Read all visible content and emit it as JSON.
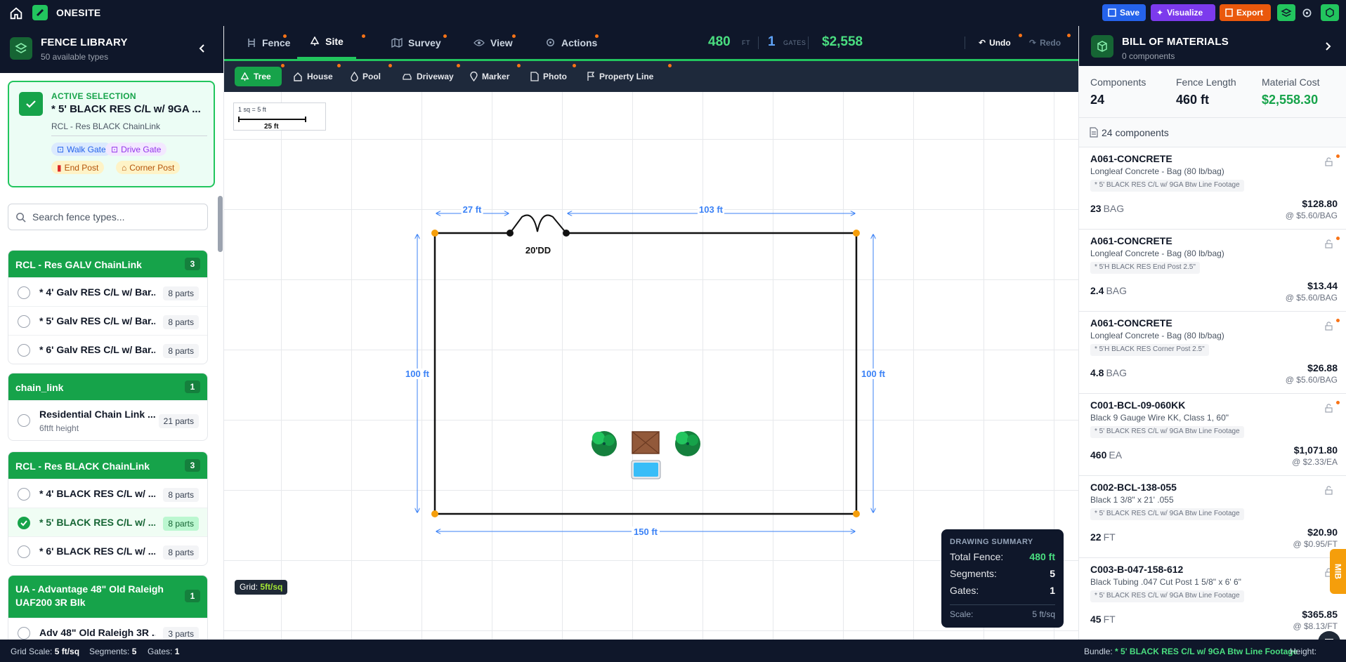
{
  "topbar": {
    "brand": "ONESITE",
    "save": "Save",
    "visualize": "Visualize",
    "export": "Export"
  },
  "library": {
    "title": "FENCE LIBRARY",
    "subtitle": "50 available types",
    "active": {
      "label": "ACTIVE SELECTION",
      "name": "* 5' BLACK RES C/L w/ 9GA ...",
      "sub": "RCL - Res BLACK ChainLink",
      "tags": [
        "Walk Gate",
        "Drive Gate",
        "End Post",
        "Corner Post"
      ]
    },
    "search_placeholder": "Search fence types...",
    "groups": [
      {
        "name": "RCL - Res GALV ChainLink",
        "count": "3",
        "rows": [
          {
            "name": "* 4' Galv RES C/L w/ Bar...",
            "parts": "8 parts"
          },
          {
            "name": "* 5' Galv RES C/L w/ Bar...",
            "parts": "8 parts"
          },
          {
            "name": "* 6' Galv RES C/L w/ Bar...",
            "parts": "8 parts"
          }
        ]
      },
      {
        "name": "chain_link",
        "count": "1",
        "rows": [
          {
            "name": "Residential Chain Link ...",
            "sub": "6ftft height",
            "parts": "21 parts"
          }
        ]
      },
      {
        "name": "RCL - Res BLACK ChainLink",
        "count": "3",
        "rows": [
          {
            "name": "* 4' BLACK RES C/L w/ ...",
            "parts": "8 parts"
          },
          {
            "name": "* 5' BLACK RES C/L w/ ...",
            "parts": "8 parts"
          },
          {
            "name": "* 6' BLACK RES C/L w/ ...",
            "parts": "8 parts"
          }
        ]
      },
      {
        "name_line1": "UA - Advantage 48\" Old Raleigh",
        "name_line2": "UAF200 3R Blk",
        "count": "1",
        "rows": [
          {
            "name": "Adv 48\" Old Raleigh 3R ...",
            "parts": "3 parts"
          }
        ]
      }
    ]
  },
  "tabs": [
    "Fence",
    "Site",
    "Survey",
    "View",
    "Actions"
  ],
  "stats": {
    "feet": "480",
    "feet_unit": "FT",
    "gates": "1",
    "gates_unit": "GATES",
    "cost": "$2,558"
  },
  "history": {
    "undo": "Undo",
    "redo": "Redo"
  },
  "site_tools": [
    "Tree",
    "House",
    "Pool",
    "Driveway",
    "Marker",
    "Photo",
    "Property Line"
  ],
  "canvas": {
    "scale_text": "1 sq = 5 ft",
    "scale_len": "25 ft",
    "dims": {
      "top_left": "27 ft",
      "top_right": "103 ft",
      "left": "100 ft",
      "right": "100 ft",
      "bottom": "150 ft"
    },
    "gate_label": "20'DD",
    "grid_label": "Grid:",
    "grid_value": "5ft/sq",
    "summary": {
      "title": "DRAWING SUMMARY",
      "total_label": "Total Fence:",
      "total": "480 ft",
      "segments_label": "Segments:",
      "segments": "5",
      "gates_label": "Gates:",
      "gates": "1",
      "scale_label": "Scale:",
      "scale": "5 ft/sq"
    }
  },
  "bom": {
    "title": "BILL OF MATERIALS",
    "subtitle": "0 components",
    "metrics": {
      "components_label": "Components",
      "components": "24",
      "length_label": "Fence Length",
      "length": "460 ft",
      "cost_label": "Material Cost",
      "cost": "$2,558.30"
    },
    "count_text": "24 components",
    "items": [
      {
        "code": "A061-CONCRETE",
        "desc": "Longleaf Concrete - Bag (80 lb/bag)",
        "tag": "* 5' BLACK RES C/L w/ 9GA Btw Line Footage",
        "qty": "23",
        "unit": "BAG",
        "price": "$128.80",
        "unit_price": "@ $5.60/BAG"
      },
      {
        "code": "A061-CONCRETE",
        "desc": "Longleaf Concrete - Bag (80 lb/bag)",
        "tag": "* 5'H BLACK RES End Post 2.5\"",
        "qty": "2.4",
        "unit": "BAG",
        "price": "$13.44",
        "unit_price": "@ $5.60/BAG"
      },
      {
        "code": "A061-CONCRETE",
        "desc": "Longleaf Concrete - Bag (80 lb/bag)",
        "tag": "* 5'H BLACK RES Corner Post 2.5\"",
        "qty": "4.8",
        "unit": "BAG",
        "price": "$26.88",
        "unit_price": "@ $5.60/BAG"
      },
      {
        "code": "C001-BCL-09-060KK",
        "desc": "Black 9 Gauge Wire KK, Class 1, 60\"",
        "tag": "* 5' BLACK RES C/L w/ 9GA Btw Line Footage",
        "qty": "460",
        "unit": "EA",
        "price": "$1,071.80",
        "unit_price": "@ $2.33/EA"
      },
      {
        "code": "C002-BCL-138-055",
        "desc": "Black 1 3/8\" x 21' .055",
        "tag": "* 5' BLACK RES C/L w/ 9GA Btw Line Footage",
        "qty": "22",
        "unit": "FT",
        "price": "$20.90",
        "unit_price": "@ $0.95/FT"
      },
      {
        "code": "C003-B-047-158-612",
        "desc": "Black Tubing .047 Cut Post 1 5/8\" x 6' 6\"",
        "tag": "* 5' BLACK RES C/L w/ 9GA Btw Line Footage",
        "qty": "45",
        "unit": "FT",
        "price": "$365.85",
        "unit_price": "@ $8.13/FT"
      }
    ],
    "mib": "MIB"
  },
  "status": {
    "grid_label": "Grid Scale:",
    "grid": "5 ft/sq",
    "segments_label": "Segments:",
    "segments": "5",
    "gates_label": "Gates:",
    "gates": "1",
    "bundle_label": "Bundle:",
    "bundle": "* 5' BLACK RES C/L w/ 9GA Btw Line Footage",
    "height_label": "Height:"
  },
  "colors": {
    "accent": "#16a34a",
    "dark": "#0f172a",
    "dimension": "#3b82f6",
    "vertex": "#f59e0b"
  }
}
